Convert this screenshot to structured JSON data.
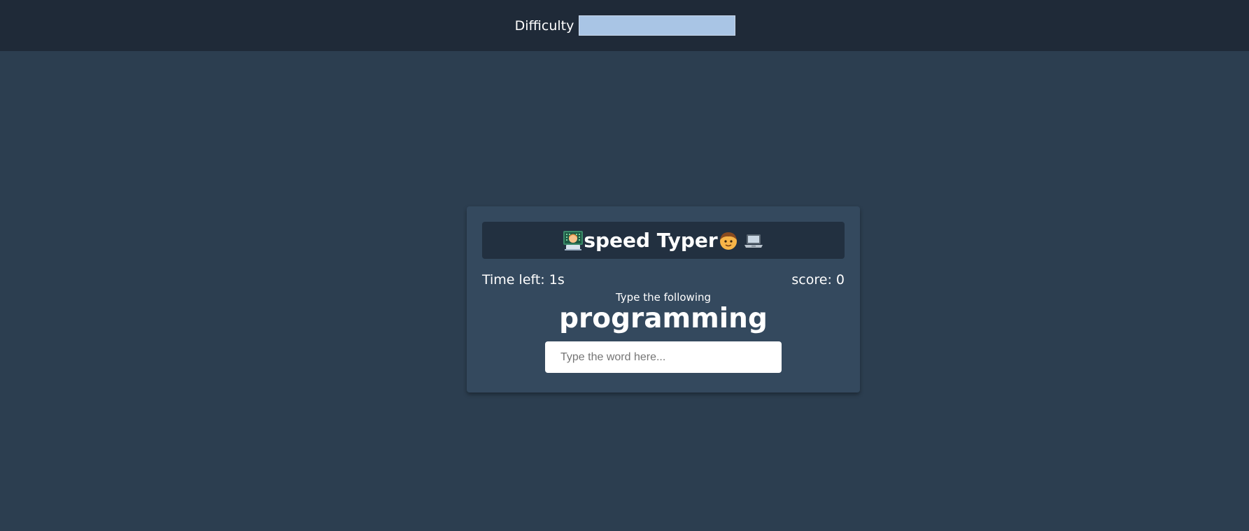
{
  "header": {
    "difficulty_label": "Difficulty",
    "difficulty_selected": ""
  },
  "game": {
    "title_text": "speed Typer",
    "title_icons": [
      "technologist-icon",
      "boy-face-icon",
      "laptop-icon"
    ],
    "time_left_text": "Time left: 1s",
    "score_text": "score: 0",
    "instruction": "Type the following",
    "word": "programming",
    "input_placeholder": "Type the word here...",
    "input_value": ""
  },
  "colors": {
    "background": "#2c3e50",
    "top_bar": "#1f2a38",
    "card": "#34495e",
    "title_box": "#223040",
    "select": "#a9c5e5"
  }
}
